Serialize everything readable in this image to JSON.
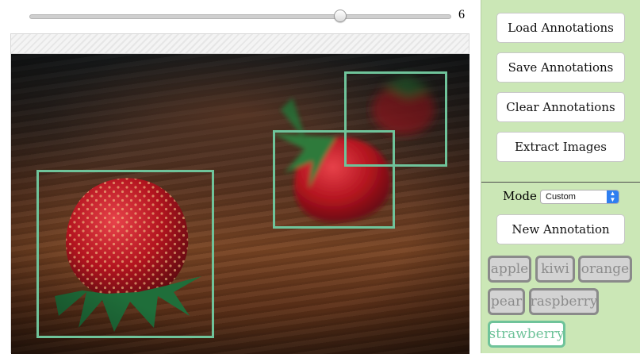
{
  "slider": {
    "value": "6",
    "level": 0.74
  },
  "canvas": {
    "photo_icon": "strawberries-photo",
    "annotation_color": "#6fc39a"
  },
  "panel": {
    "background": "#cbe7b6",
    "buttons": {
      "load": "Load Annotations",
      "save": "Save Annotations",
      "clear": "Clear Annotations",
      "extract": "Extract Images",
      "new_annotation": "New Annotation"
    },
    "mode_label": "Mode",
    "mode_value": "Custom",
    "tags": [
      "apple",
      "kiwi",
      "orange",
      "pear",
      "raspberry",
      "strawberry"
    ],
    "active_tag": "strawberry"
  }
}
